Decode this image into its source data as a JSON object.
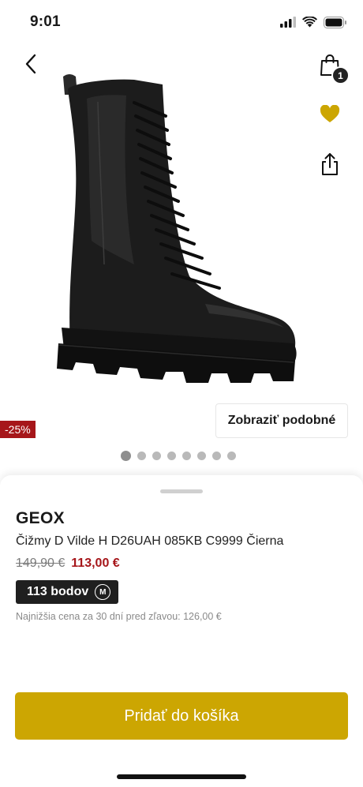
{
  "status_bar": {
    "time": "9:01"
  },
  "nav": {
    "back_icon": "chevron-left-icon",
    "cart_icon": "shopping-bag-icon",
    "cart_count": "1",
    "favorite_icon": "heart-icon",
    "share_icon": "share-icon"
  },
  "gallery": {
    "discount_badge": "-25%",
    "similar_label": "Zobraziť podobné",
    "image_count": 8,
    "active_index": 0
  },
  "product": {
    "brand": "GEOX",
    "name": "Čižmy D Vilde H D26UAH 085KB C9999 Čierna",
    "old_price": "149,90 €",
    "new_price": "113,00 €",
    "points_label": "113 bodov",
    "points_icon_letter": "M",
    "lowest_price_note": "Najnižšia cena za 30 dní pred zľavou: 126,00 €"
  },
  "actions": {
    "add_to_cart_label": "Pridať do košíka"
  },
  "colors": {
    "accent_gold": "#cca602",
    "sale_red": "#a6161a",
    "dark": "#1f1f1f"
  }
}
